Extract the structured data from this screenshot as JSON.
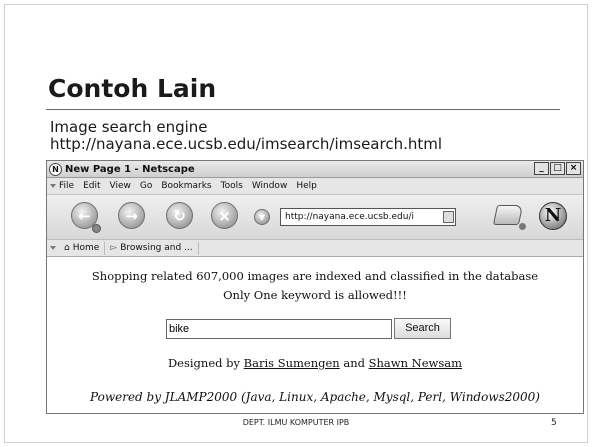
{
  "slide": {
    "title": "Contoh Lain",
    "bullet_line1": "Image search engine",
    "bullet_line2": "http://nayana.ece.ucsb.edu/imsearch/imsearch.html",
    "footer": "DEPT. ILMU KOMPUTER IPB",
    "page_number": "5"
  },
  "browser": {
    "window_title": "New Page 1 - Netscape",
    "controls": {
      "minimize": "_",
      "maximize": "□",
      "close": "×"
    },
    "menu": [
      {
        "label": "File"
      },
      {
        "label": "Edit"
      },
      {
        "label": "View"
      },
      {
        "label": "Go"
      },
      {
        "label": "Bookmarks"
      },
      {
        "label": "Tools"
      },
      {
        "label": "Window"
      },
      {
        "label": "Help"
      }
    ],
    "url": "http://nayana.ece.ucsb.edu/i",
    "personal_toolbar": {
      "home": "Home",
      "bookmark": "Browsing and ..."
    }
  },
  "page": {
    "line1": "Shopping related 607,000 images are indexed and classified in the database",
    "line2": "Only One keyword is allowed!!!",
    "search_value": "bike",
    "search_button": "Search",
    "designed_prefix": "Designed by",
    "author1": "Baris Sumengen",
    "designed_and": "and",
    "author2": "Shawn Newsam",
    "powered": "Powered by JLAMP2000 (Java, Linux, Apache, Mysql, Perl, Windows2000)"
  },
  "icons": {
    "back": "back-arrow-icon",
    "forward": "forward-arrow-icon",
    "reload": "reload-icon",
    "stop": "stop-icon",
    "print": "print-icon",
    "logo": "netscape-logo-icon",
    "home": "home-icon",
    "bookmark": "bookmark-icon"
  }
}
